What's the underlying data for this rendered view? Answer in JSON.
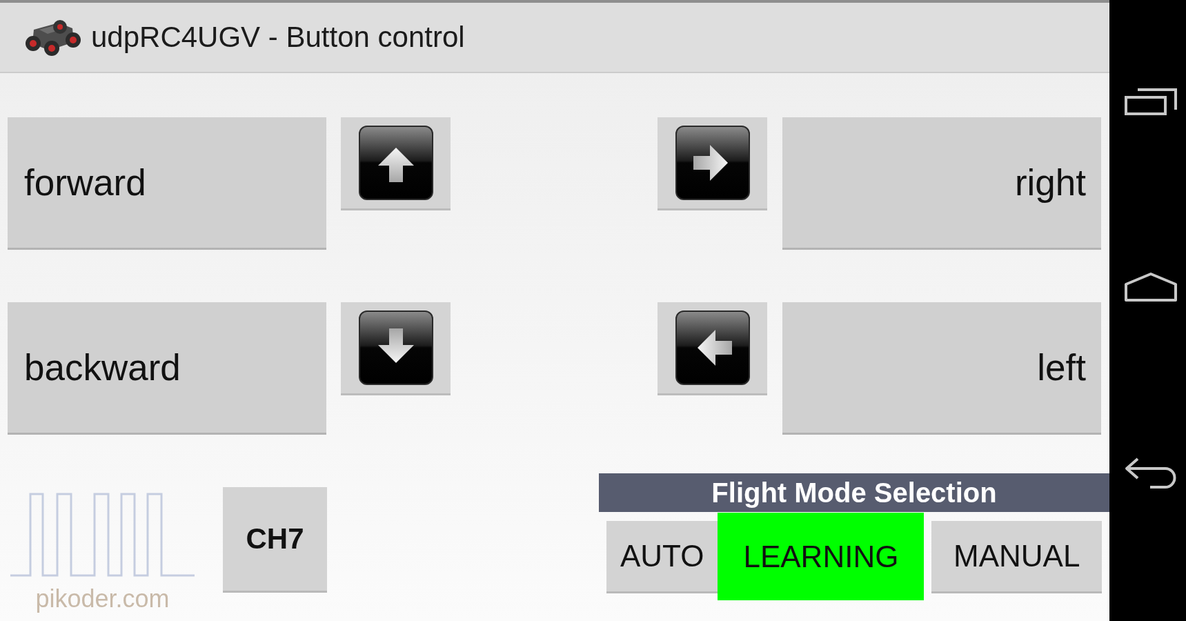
{
  "title_bar": {
    "title": "udpRC4UGV - Button control"
  },
  "drive_rows": [
    {
      "left": {
        "label": "forward",
        "kind": "up"
      },
      "right": {
        "label": "right",
        "kind": "right"
      }
    },
    {
      "left": {
        "label": "backward",
        "kind": "down"
      },
      "right": {
        "label": "left",
        "kind": "left"
      }
    }
  ],
  "logo": {
    "text": "pikoder.com"
  },
  "channel_button": {
    "label": "CH7"
  },
  "flight_mode": {
    "title": "Flight Mode Selection",
    "modes": [
      {
        "label": "AUTO",
        "selected": false
      },
      {
        "label": "LEARNING",
        "selected": true
      },
      {
        "label": "MANUAL",
        "selected": false
      }
    ]
  }
}
